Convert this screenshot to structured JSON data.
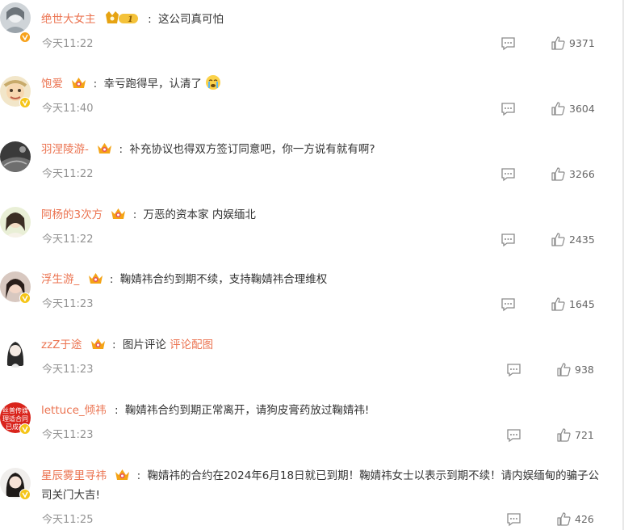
{
  "accent_color": "#eb7350",
  "comments": [
    {
      "user": "绝世大女主",
      "badge": "vip-1",
      "text": "这公司真可怕",
      "time": "今天11:22",
      "likes": "9371"
    },
    {
      "user": "饱爱",
      "badge": "crown",
      "text": "幸亏跑得早，认清了",
      "emoji": "crying-face",
      "time": "今天11:40",
      "likes": "3604"
    },
    {
      "user": "羽涅陵游-",
      "badge": "crown",
      "text": "补充协议也得双方签订同意吧，你一方说有就有啊?",
      "time": "今天11:22",
      "likes": "3266"
    },
    {
      "user": "阿杨的3次方",
      "badge": "crown",
      "text": "万恶的资本家 内娱缅北",
      "time": "今天11:22",
      "likes": "2435"
    },
    {
      "user": "浮生游_",
      "badge": "crown",
      "text": "鞠婧祎合约到期不续，支持鞠婧祎合理维权",
      "time": "今天11:23",
      "likes": "1645"
    },
    {
      "user": "zzZ于途",
      "badge": "crown",
      "text": "图片评论",
      "link": "评论配图",
      "time": "今天11:23",
      "likes": "938"
    },
    {
      "user": "lettuce_倾祎",
      "badge": "none",
      "text": "鞠婧祎合约到期正常离开，请狗皮膏药放过鞠婧祎!",
      "time": "今天11:23",
      "likes": "721"
    },
    {
      "user": "星辰雾里寻祎",
      "badge": "crown",
      "text": "鞠婧祎的合约在2024年6月18日就已到期！鞠婧祎女士以表示到期不续！请内娱缅甸的骗子公司关门大吉!",
      "time": "今天11:25",
      "likes": "426"
    }
  ],
  "avatar_texts": {
    "lettuce": "丝普传媒 理适合同 已成被"
  }
}
